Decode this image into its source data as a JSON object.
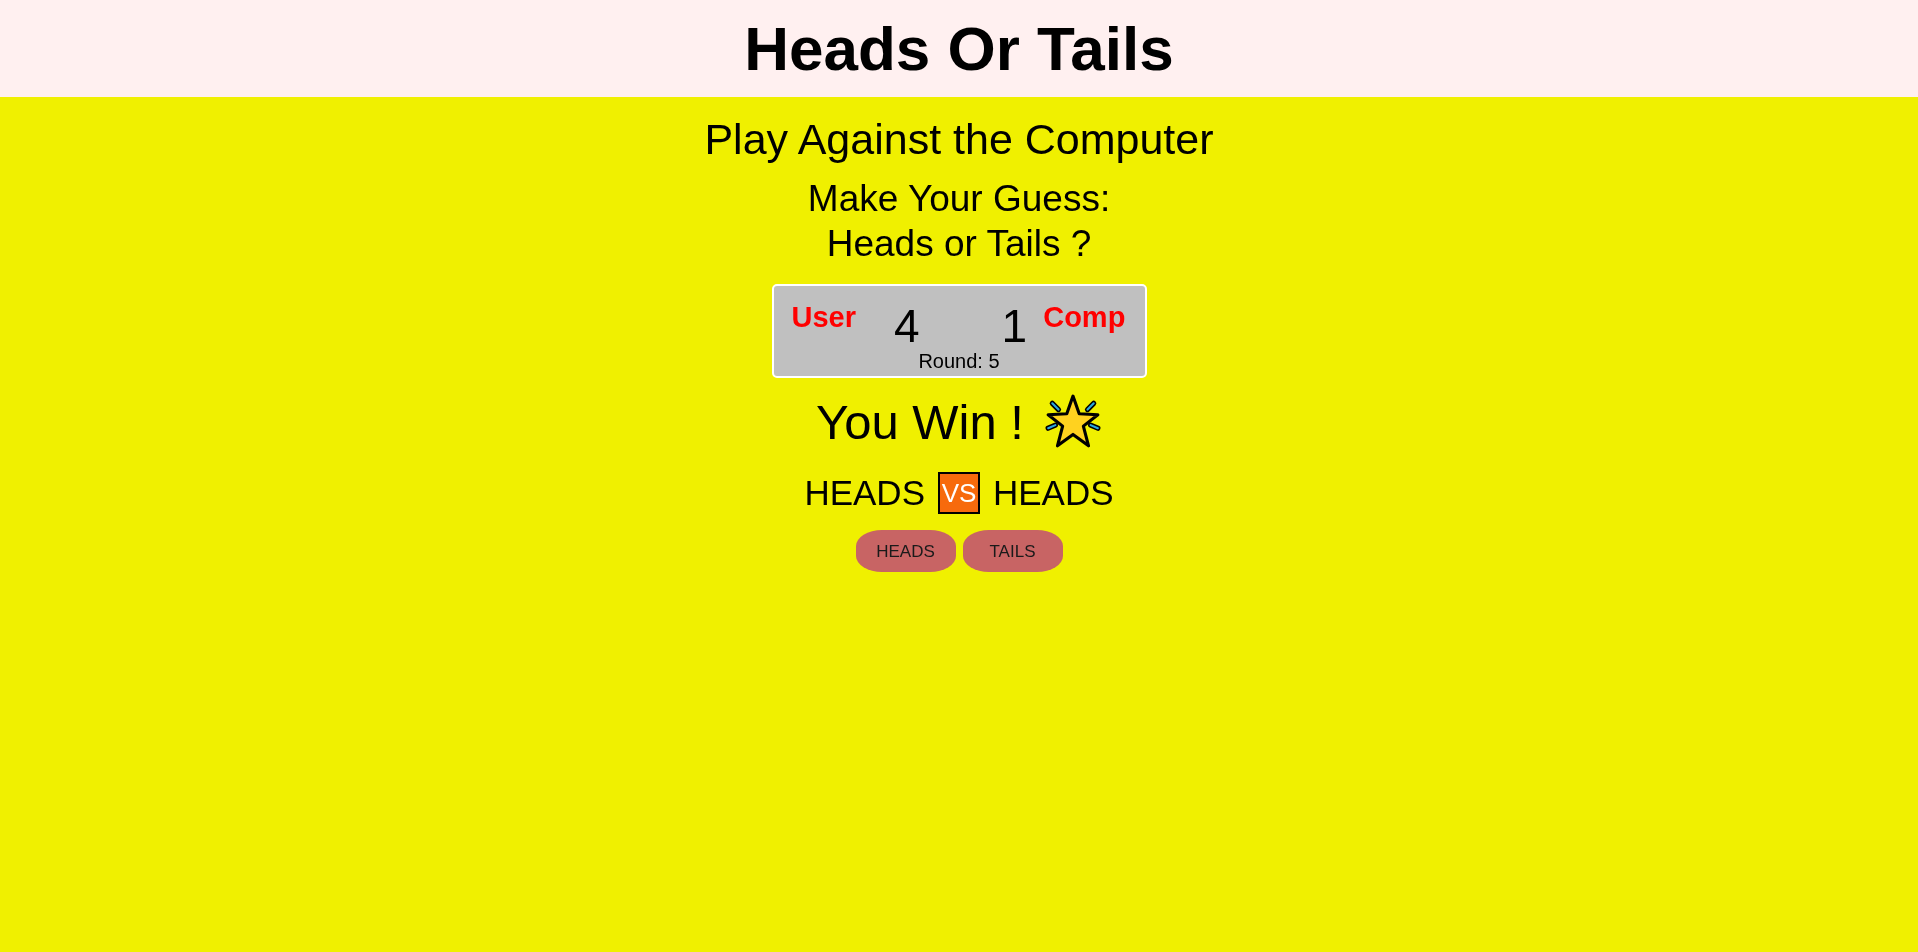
{
  "header": {
    "title": "Heads Or Tails"
  },
  "subtitle": "Play Against the Computer",
  "prompt": [
    "Make Your Guess:",
    "Heads or Tails ?"
  ],
  "scoreboard": {
    "user_label": "User",
    "user_score": "4",
    "comp_score": "1",
    "comp_label": "Comp",
    "round": "Round: 5"
  },
  "result": {
    "message": "You Win !",
    "won": true
  },
  "matchup": {
    "user_choice": "HEADS",
    "vs": "VS",
    "comp_choice": "HEADS"
  },
  "buttons": [
    "HEADS",
    "TAILS"
  ]
}
